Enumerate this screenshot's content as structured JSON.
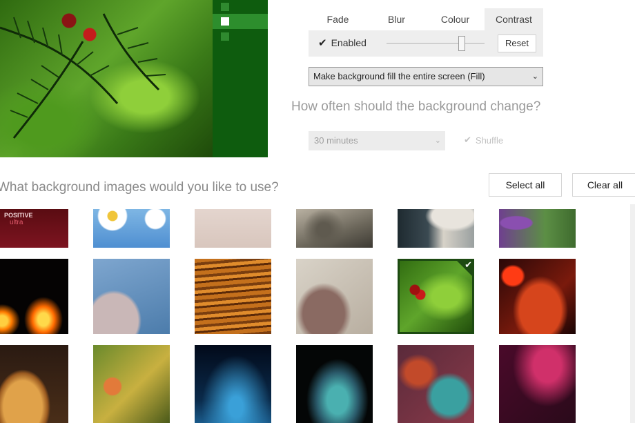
{
  "effects": {
    "tabs": [
      "Fade",
      "Blur",
      "Colour",
      "Contrast"
    ],
    "active_tab": "Contrast",
    "enabled_label": "Enabled",
    "enabled_checked": true,
    "slider_level": 0.77,
    "reset_label": "Reset"
  },
  "fill_mode": {
    "selected": "Make background fill the entire screen (Fill)"
  },
  "change": {
    "heading": "How often should the background change?",
    "interval": "30 minutes",
    "shuffle_label": "Shuffle"
  },
  "images": {
    "heading": "What background images would you like to use?",
    "select_all_label": "Select all",
    "clear_all_label": "Clear all",
    "thumb_logo_line1": "POSITIVE",
    "thumb_logo_line2": "ultra",
    "selected_index": 10
  },
  "icons": {
    "check": "✔",
    "chevron": "⌄"
  },
  "colors": {
    "accent_green": "#0e5c0e",
    "selection": "#1d4a12"
  }
}
